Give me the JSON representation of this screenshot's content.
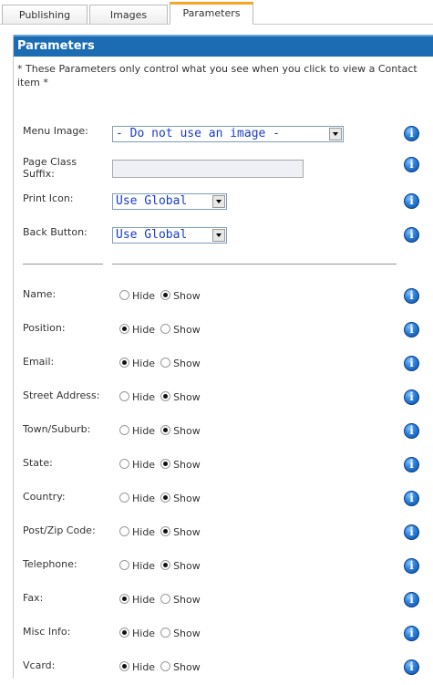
{
  "tabs": [
    {
      "label": "Publishing"
    },
    {
      "label": "Images"
    },
    {
      "label": "Parameters"
    }
  ],
  "panel": {
    "title": "Parameters",
    "description": "* These Parameters only control what you see when you click to view a Contact item *"
  },
  "params": {
    "menu_image": {
      "label": "Menu Image:",
      "value": "- Do not use an image -"
    },
    "page_class_suffix": {
      "label": "Page Class Suffix:",
      "value": ""
    },
    "print_icon": {
      "label": "Print Icon:",
      "value": "Use Global"
    },
    "back_button": {
      "label": "Back Button:",
      "value": "Use Global"
    }
  },
  "radio_labels": {
    "hide": "Hide",
    "show": "Show"
  },
  "fields": [
    {
      "label": "Name:",
      "selected": "show"
    },
    {
      "label": "Position:",
      "selected": "hide"
    },
    {
      "label": "Email:",
      "selected": "hide"
    },
    {
      "label": "Street Address:",
      "selected": "show"
    },
    {
      "label": "Town/Suburb:",
      "selected": "show"
    },
    {
      "label": "State:",
      "selected": "show"
    },
    {
      "label": "Country:",
      "selected": "show"
    },
    {
      "label": "Post/Zip Code:",
      "selected": "show"
    },
    {
      "label": "Telephone:",
      "selected": "show"
    },
    {
      "label": "Fax:",
      "selected": "hide"
    },
    {
      "label": "Misc Info:",
      "selected": "hide"
    },
    {
      "label": "Vcard:",
      "selected": "hide"
    }
  ],
  "icons": {
    "info": "info-icon"
  },
  "colors": {
    "header_bg": "#1b6cb3",
    "active_tab_accent": "#f5a623",
    "select_text": "#1a3cc8"
  }
}
